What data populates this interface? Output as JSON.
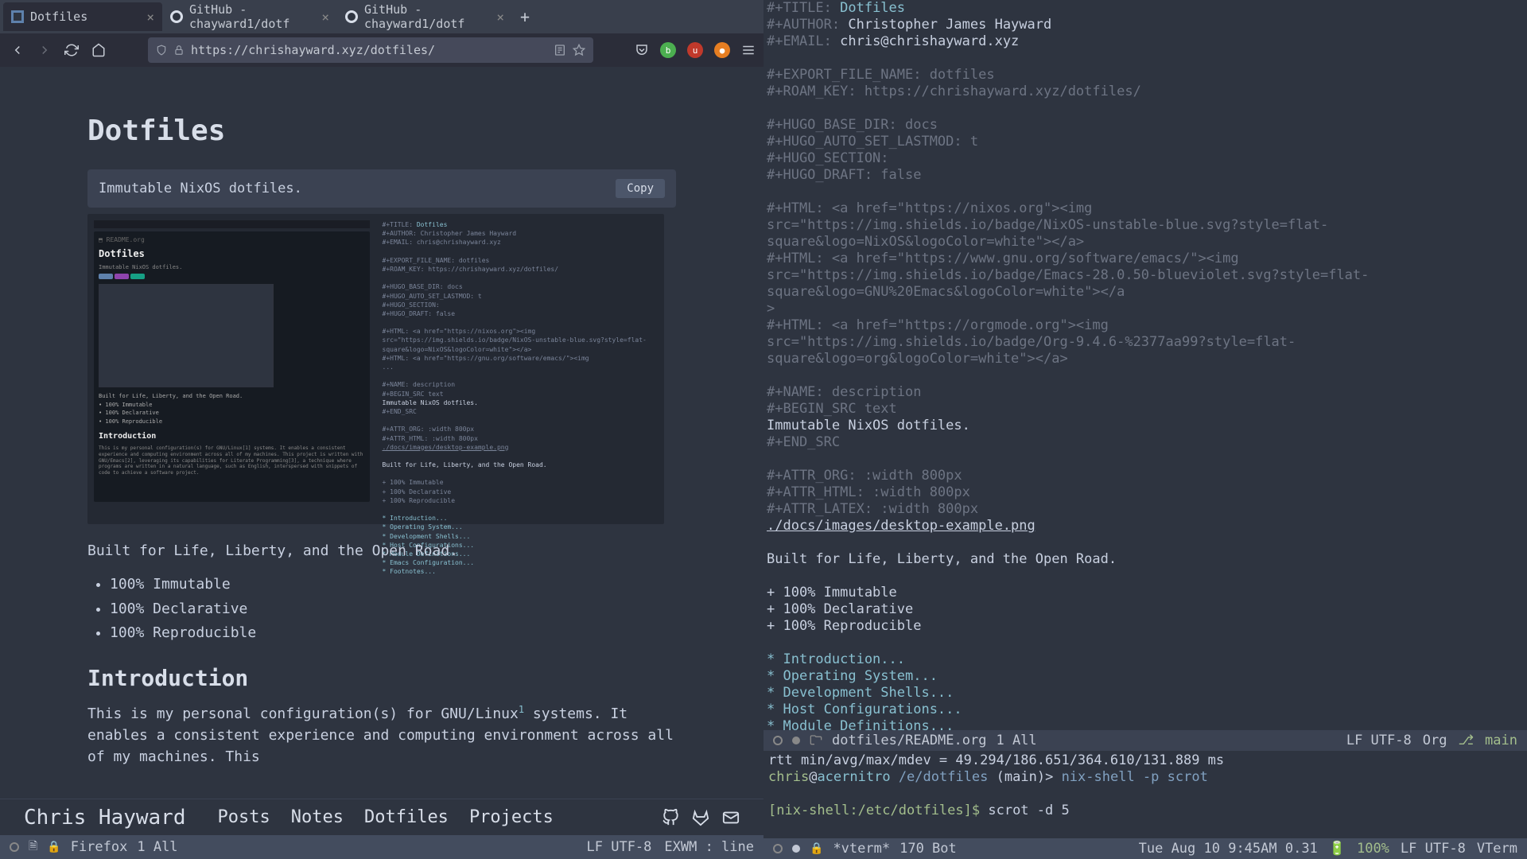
{
  "tabs": [
    {
      "title": "Dotfiles",
      "active": true
    },
    {
      "title": "GitHub - chayward1/dotf",
      "active": false
    },
    {
      "title": "GitHub - chayward1/dotf",
      "active": false
    }
  ],
  "url": "https://chrishayward.xyz/dotfiles/",
  "page": {
    "heading": "Dotfiles",
    "codebox": "Immutable NixOS dotfiles.",
    "copy": "Copy",
    "tagline": "Built for Life, Liberty, and the Open Road.",
    "bullets": [
      "100% Immutable",
      "100% Declarative",
      "100% Reproducible"
    ],
    "intro_h": "Introduction",
    "intro_p": "This is my personal configuration(s) for GNU/Linux",
    "intro_sup": "1",
    "intro_p2": " systems. It enables a consistent experience and computing environment across all of my machines. This"
  },
  "site_nav": {
    "title": "Chris Hayward",
    "links": [
      "Posts",
      "Notes",
      "Dotfiles",
      "Projects"
    ]
  },
  "left_modeline": {
    "buf": "Firefox",
    "pos": "1 All",
    "enc": "LF UTF-8",
    "mode": "EXWM : line"
  },
  "org": {
    "title_key": "#+TITLE: ",
    "title_val": "Dotfiles",
    "author_key": "#+AUTHOR: ",
    "author_val": "Christopher James Hayward",
    "email_key": "#+EMAIL: ",
    "email_val": "chris@chrishayward.xyz",
    "export_name": "#+EXPORT_FILE_NAME: dotfiles",
    "roam_key": "#+ROAM_KEY: https://chrishayward.xyz/dotfiles/",
    "hugo_base": "#+HUGO_BASE_DIR: docs",
    "hugo_lastmod": "#+HUGO_AUTO_SET_LASTMOD: t",
    "hugo_section": "#+HUGO_SECTION:",
    "hugo_draft": "#+HUGO_DRAFT: false",
    "html1a": "#+HTML: <a href=\"https://nixos.org\"><img",
    "html1b": "src=\"https://img.shields.io/badge/NixOS-unstable-blue.svg?style=flat-square&logo=NixOS&logoColor=white\"></a>",
    "html2a": "#+HTML: <a href=\"https://www.gnu.org/software/emacs/\"><img",
    "html2b": "src=\"https://img.shields.io/badge/Emacs-28.0.50-blueviolet.svg?style=flat-square&logo=GNU%20Emacs&logoColor=white\"></a",
    "html2c": ">",
    "html3a": "#+HTML: <a href=\"https://orgmode.org\"><img",
    "html3b": "src=\"https://img.shields.io/badge/Org-9.4.6-%2377aa99?style=flat-square&logo=org&logoColor=white\"></a>",
    "name_desc": "#+NAME: description",
    "begin_src": "#+BEGIN_SRC text",
    "src_body": "Immutable NixOS dotfiles.",
    "end_src": "#+END_SRC",
    "attr_org": "#+ATTR_ORG: :width 800px",
    "attr_html": "#+ATTR_HTML: :width 800px",
    "attr_latex": "#+ATTR_LATEX: :width 800px",
    "img_link": "./docs/images/desktop-example.png",
    "built_for": "Built for Life, Liberty, and the Open Road.",
    "b1": "+ 100% Immutable",
    "b2": "+ 100% Declarative",
    "b3": "+ 100% Reproducible",
    "h1": "* Introduction...",
    "h2": "* Operating System...",
    "h3": "* Development Shells...",
    "h4": "* Host Configurations...",
    "h5": "* Module Definitions...",
    "h6": "* Emacs Configuration..."
  },
  "ed_modeline": {
    "path": "dotfiles/README.org",
    "pos": "1 All",
    "enc": "LF UTF-8",
    "mode": "Org",
    "branch": "main"
  },
  "vterm": {
    "rtt": "rtt min/avg/max/mdev = 49.294/186.651/364.610/131.889 ms",
    "user": "chris",
    "host": "acernitro",
    "path": "/e/dotfiles",
    "branch": "(main)>",
    "cmd1": "nix-shell",
    "cmd1_args": " -p scrot",
    "nix_prompt": "[nix-shell:/etc/dotfiles]$",
    "cmd2": "scrot -d 5"
  },
  "vt_modeline": {
    "buf": "*vterm*",
    "pos": "170 Bot",
    "time": "Tue Aug 10 9:45AM 0.31",
    "batt": "100%",
    "enc": "LF UTF-8",
    "mode": "VTerm"
  }
}
